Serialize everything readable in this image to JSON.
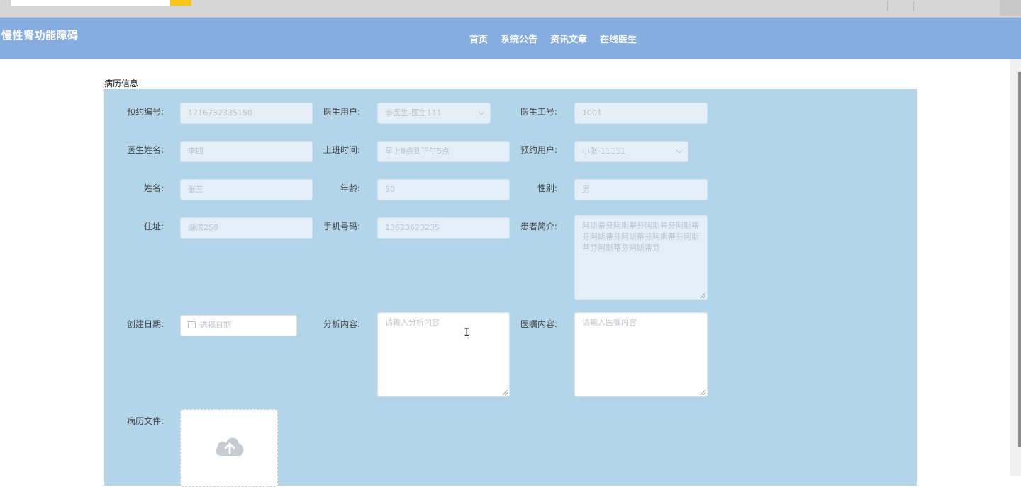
{
  "site": {
    "logo": "慢性肾功能障碍",
    "nav": [
      "首页",
      "系统公告",
      "资讯文章",
      "在线医生"
    ]
  },
  "section_title": "病历信息",
  "form": {
    "appointment_no": {
      "label": "预约编号:",
      "value": "1716732335150"
    },
    "doctor_user": {
      "label": "医生用户:",
      "value": "李医生-医生111"
    },
    "doctor_id": {
      "label": "医生工号:",
      "value": "1001"
    },
    "doctor_name": {
      "label": "医生姓名:",
      "value": "李四"
    },
    "work_time": {
      "label": "上班时间:",
      "value": "早上8点到下午5点"
    },
    "booking_user": {
      "label": "预约用户:",
      "value": "小张-11111"
    },
    "name": {
      "label": "姓名:",
      "value": "张三"
    },
    "age": {
      "label": "年龄:",
      "value": "50"
    },
    "gender": {
      "label": "性别:",
      "value": "男"
    },
    "address": {
      "label": "住址:",
      "value": "湖滨258"
    },
    "phone": {
      "label": "手机号码:",
      "value": "13623623235"
    },
    "patient_intro": {
      "label": "患者简介:",
      "value": "阿斯蒂芬阿斯蒂芬阿斯蒂芬阿斯蒂芬阿斯蒂芬阿斯蒂芬阿斯蒂芬阿斯蒂芬阿斯蒂芬阿斯蒂芬"
    },
    "create_date": {
      "label": "创建日期:",
      "placeholder": "选择日期"
    },
    "analysis": {
      "label": "分析内容:",
      "placeholder": "请输入分析内容"
    },
    "advice": {
      "label": "医嘱内容:",
      "placeholder": "请输入医嘱内容"
    },
    "record_file": {
      "label": "病历文件:"
    }
  },
  "icons": {
    "calendar": "calendar-icon",
    "upload": "cloud-upload-icon",
    "dropdown": "chevron-down-icon"
  },
  "colors": {
    "header": "#85ade0",
    "panel": "#b3d5ea"
  }
}
